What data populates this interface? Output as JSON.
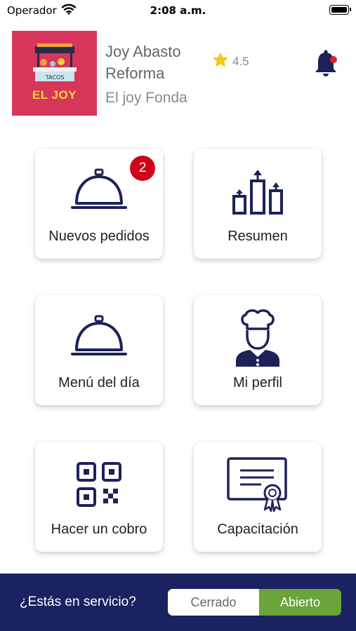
{
  "status_bar": {
    "carrier": "Operador",
    "time": "2:08 a.m.",
    "icons": [
      "wifi-icon",
      "battery-icon"
    ]
  },
  "header": {
    "logo_text": "EL JOY",
    "logo_sign": "TACOS",
    "business_name": "Joy Abasto Reforma",
    "subtitle": "El joy Fonda",
    "rating": "4.5",
    "rating_icon": "star-icon",
    "notification_icon": "bell-icon"
  },
  "menu": [
    {
      "label": "Nuevos pedidos",
      "icon": "service-bell-icon",
      "badge": "2"
    },
    {
      "label": "Resumen",
      "icon": "bar-chart-icon"
    },
    {
      "label": "Menú del día",
      "icon": "service-bell-icon"
    },
    {
      "label": "Mi perfil",
      "icon": "chef-icon"
    },
    {
      "label": "Hacer un cobro",
      "icon": "qr-code-icon"
    },
    {
      "label": "Capacitación",
      "icon": "certificate-icon"
    }
  ],
  "service": {
    "question": "¿Estás en servicio?",
    "closed_label": "Cerrado",
    "open_label": "Abierto",
    "selected": "Abierto"
  },
  "colors": {
    "navy": "#1a2360",
    "icon_navy": "#1c2258",
    "badge_red": "#d0021b",
    "toggle_green": "#6aa43a",
    "logo_pink": "#d6365a",
    "star_yellow": "#f5c518",
    "bell_dot_red": "#e2202a"
  }
}
